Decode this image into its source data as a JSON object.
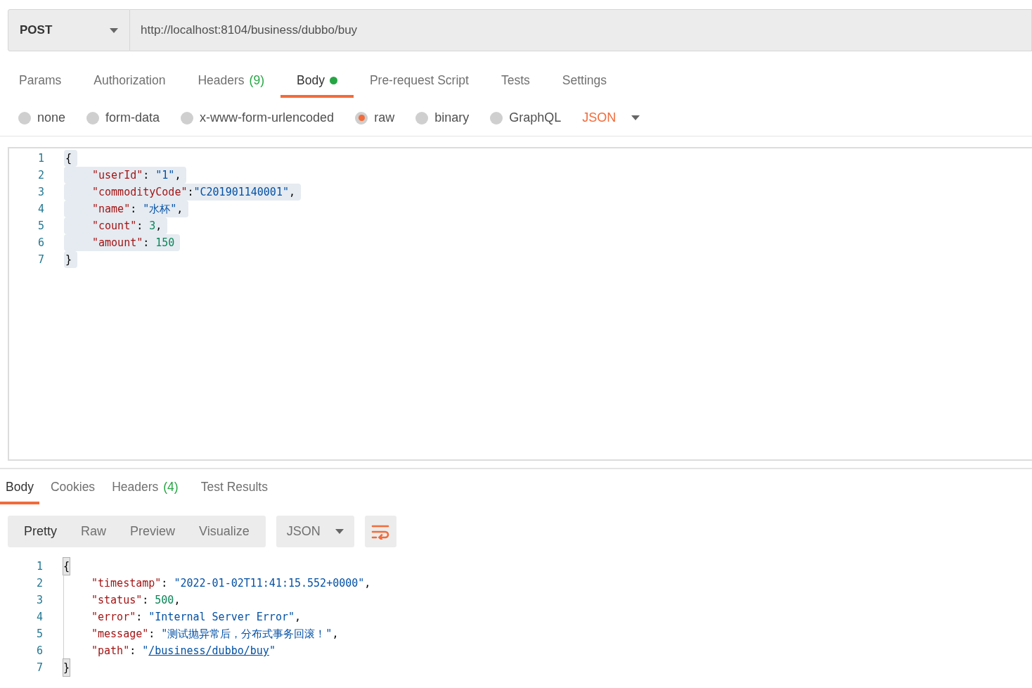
{
  "request": {
    "method": "POST",
    "url": "http://localhost:8104/business/dubbo/buy"
  },
  "request_tabs": [
    {
      "label": "Params",
      "selected": false
    },
    {
      "label": "Authorization",
      "selected": false
    },
    {
      "label": "Headers",
      "count": "(9)",
      "selected": false
    },
    {
      "label": "Body",
      "dot": true,
      "selected": true
    },
    {
      "label": "Pre-request Script",
      "selected": false
    },
    {
      "label": "Tests",
      "selected": false
    },
    {
      "label": "Settings",
      "selected": false
    }
  ],
  "body_types": [
    {
      "label": "none",
      "selected": false
    },
    {
      "label": "form-data",
      "selected": false
    },
    {
      "label": "x-www-form-urlencoded",
      "selected": false
    },
    {
      "label": "raw",
      "selected": true
    },
    {
      "label": "binary",
      "selected": false
    },
    {
      "label": "GraphQL",
      "selected": false
    }
  ],
  "raw_format": "JSON",
  "request_body": [
    {
      "number": "1",
      "selected": true,
      "indented": false,
      "tokens": [
        {
          "kind": "punct",
          "text": "{"
        }
      ]
    },
    {
      "number": "2",
      "selected": true,
      "indented": true,
      "tokens": [
        {
          "kind": "key",
          "text": "\"userId\""
        },
        {
          "kind": "punct",
          "text": ": "
        },
        {
          "kind": "string",
          "text": "\"1\""
        },
        {
          "kind": "punct",
          "text": ","
        }
      ]
    },
    {
      "number": "3",
      "selected": true,
      "indented": true,
      "tokens": [
        {
          "kind": "key",
          "text": "\"commodityCode\""
        },
        {
          "kind": "punct",
          "text": ":"
        },
        {
          "kind": "string",
          "text": "\"C201901140001\""
        },
        {
          "kind": "punct",
          "text": ","
        }
      ]
    },
    {
      "number": "4",
      "selected": true,
      "indented": true,
      "tokens": [
        {
          "kind": "key",
          "text": "\"name\""
        },
        {
          "kind": "punct",
          "text": ": "
        },
        {
          "kind": "string",
          "text": "\"水杯\""
        },
        {
          "kind": "punct",
          "text": ","
        }
      ]
    },
    {
      "number": "5",
      "selected": true,
      "indented": true,
      "tokens": [
        {
          "kind": "key",
          "text": "\"count\""
        },
        {
          "kind": "punct",
          "text": ": "
        },
        {
          "kind": "number",
          "text": "3"
        },
        {
          "kind": "punct",
          "text": ","
        }
      ]
    },
    {
      "number": "6",
      "selected": true,
      "indented": true,
      "tokens": [
        {
          "kind": "key",
          "text": "\"amount\""
        },
        {
          "kind": "punct",
          "text": ": "
        },
        {
          "kind": "number",
          "text": "150"
        }
      ]
    },
    {
      "number": "7",
      "selected": true,
      "indented": false,
      "tokens": [
        {
          "kind": "punct",
          "text": "}"
        }
      ]
    }
  ],
  "response_tabs": [
    {
      "label": "Body",
      "selected": true
    },
    {
      "label": "Cookies",
      "selected": false
    },
    {
      "label": "Headers",
      "count": "(4)",
      "selected": false
    },
    {
      "label": "Test Results",
      "selected": false
    }
  ],
  "view_modes": [
    {
      "label": "Pretty",
      "selected": true
    },
    {
      "label": "Raw",
      "selected": false
    },
    {
      "label": "Preview",
      "selected": false
    },
    {
      "label": "Visualize",
      "selected": false
    }
  ],
  "response_format": "JSON",
  "response_body": [
    {
      "number": "1",
      "bracket_match": true,
      "indented": false,
      "tokens": [
        {
          "kind": "punct",
          "text": "{"
        }
      ]
    },
    {
      "number": "2",
      "bracket_match": false,
      "indented": true,
      "tokens": [
        {
          "kind": "key",
          "text": "\"timestamp\""
        },
        {
          "kind": "punct",
          "text": ": "
        },
        {
          "kind": "string",
          "text": "\"2022-01-02T11:41:15.552+0000\""
        },
        {
          "kind": "punct",
          "text": ","
        }
      ]
    },
    {
      "number": "3",
      "bracket_match": false,
      "indented": true,
      "tokens": [
        {
          "kind": "key",
          "text": "\"status\""
        },
        {
          "kind": "punct",
          "text": ": "
        },
        {
          "kind": "number",
          "text": "500"
        },
        {
          "kind": "punct",
          "text": ","
        }
      ]
    },
    {
      "number": "4",
      "bracket_match": false,
      "indented": true,
      "tokens": [
        {
          "kind": "key",
          "text": "\"error\""
        },
        {
          "kind": "punct",
          "text": ": "
        },
        {
          "kind": "string",
          "text": "\"Internal Server Error\""
        },
        {
          "kind": "punct",
          "text": ","
        }
      ]
    },
    {
      "number": "5",
      "bracket_match": false,
      "indented": true,
      "tokens": [
        {
          "kind": "key",
          "text": "\"message\""
        },
        {
          "kind": "punct",
          "text": ": "
        },
        {
          "kind": "string",
          "text": "\"测试抛异常后，分布式事务回滚！\""
        },
        {
          "kind": "punct",
          "text": ","
        }
      ]
    },
    {
      "number": "6",
      "bracket_match": false,
      "indented": true,
      "tokens": [
        {
          "kind": "key",
          "text": "\"path\""
        },
        {
          "kind": "punct",
          "text": ": "
        },
        {
          "kind": "string",
          "text": "\""
        },
        {
          "kind": "link",
          "text": "/business/dubbo/buy"
        },
        {
          "kind": "string",
          "text": "\""
        }
      ]
    },
    {
      "number": "7",
      "bracket_match": true,
      "indented": false,
      "tokens": [
        {
          "kind": "punct",
          "text": "}"
        }
      ]
    }
  ]
}
